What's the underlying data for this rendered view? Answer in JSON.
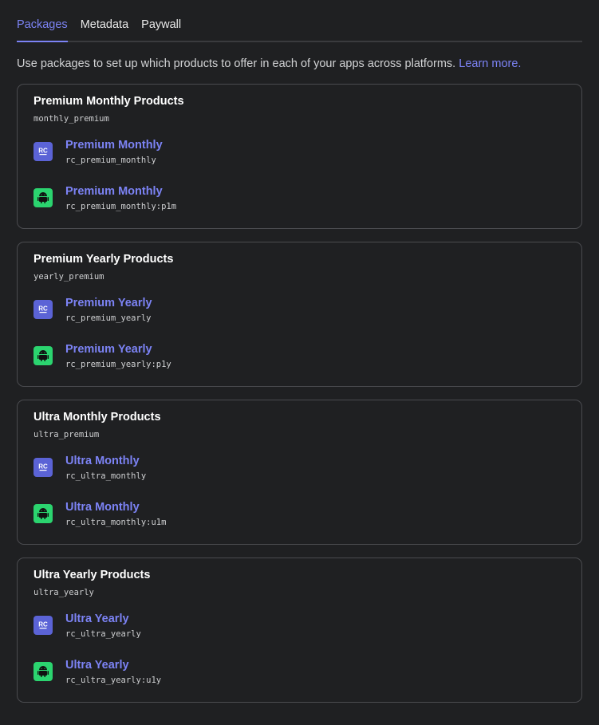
{
  "tabs": [
    {
      "label": "Packages",
      "active": true
    },
    {
      "label": "Metadata",
      "active": false
    },
    {
      "label": "Paywall",
      "active": false
    }
  ],
  "description": {
    "text": "Use packages to set up which products to offer in each of your apps across platforms.",
    "link": "Learn more."
  },
  "colors": {
    "accent": "#7c83f5",
    "rc_icon_bg": "#5b63d6",
    "android_icon_bg": "#2bd46f",
    "background": "#1f2022"
  },
  "packages": [
    {
      "title": "Premium Monthly Products",
      "identifier": "monthly_premium",
      "products": [
        {
          "icon": "rc-icon",
          "name": "Premium Monthly",
          "id": "rc_premium_monthly"
        },
        {
          "icon": "android-icon",
          "name": "Premium Monthly",
          "id": "rc_premium_monthly:p1m"
        }
      ]
    },
    {
      "title": "Premium Yearly Products",
      "identifier": "yearly_premium",
      "products": [
        {
          "icon": "rc-icon",
          "name": "Premium Yearly",
          "id": "rc_premium_yearly"
        },
        {
          "icon": "android-icon",
          "name": "Premium Yearly",
          "id": "rc_premium_yearly:p1y"
        }
      ]
    },
    {
      "title": "Ultra Monthly Products",
      "identifier": "ultra_premium",
      "products": [
        {
          "icon": "rc-icon",
          "name": "Ultra Monthly",
          "id": "rc_ultra_monthly"
        },
        {
          "icon": "android-icon",
          "name": "Ultra Monthly",
          "id": "rc_ultra_monthly:u1m"
        }
      ]
    },
    {
      "title": "Ultra Yearly Products",
      "identifier": "ultra_yearly",
      "products": [
        {
          "icon": "rc-icon",
          "name": "Ultra Yearly",
          "id": "rc_ultra_yearly"
        },
        {
          "icon": "android-icon",
          "name": "Ultra Yearly",
          "id": "rc_ultra_yearly:u1y"
        }
      ]
    }
  ]
}
